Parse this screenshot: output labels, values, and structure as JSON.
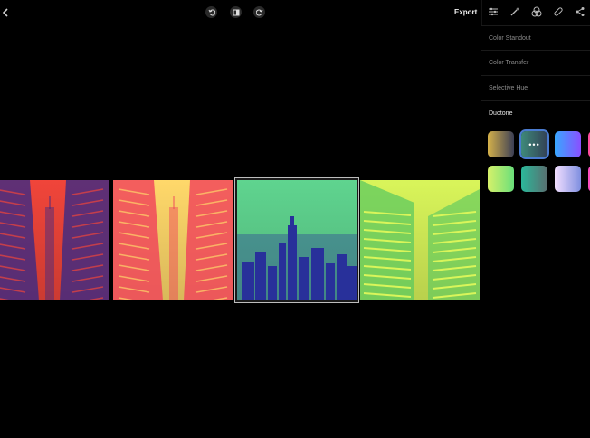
{
  "toolbar": {
    "back_icon": "chevron-left-icon",
    "undo_icon": "undo-icon",
    "compare_icon": "compare-icon",
    "redo_icon": "redo-icon",
    "export_label": "Export"
  },
  "panel_tabs": [
    "sliders-icon",
    "magic-wand-icon",
    "color-drops-icon",
    "bandage-icon",
    "share-icon"
  ],
  "panel": {
    "menu": [
      "Color Standout",
      "Color Transfer",
      "Selective Hue"
    ],
    "section_title": "Duotone",
    "swatches": [
      {
        "name": "gold-gray",
        "colors": [
          "#d6b24a",
          "#3c3f55"
        ]
      },
      {
        "name": "teal-gray",
        "colors": [
          "#3e8a7a",
          "#334055"
        ],
        "selected": true
      },
      {
        "name": "blue-violet",
        "colors": [
          "#38a8ff",
          "#8a4fff"
        ]
      },
      {
        "name": "pink",
        "colors": [
          "#ff4fa0",
          "#ff2d80"
        ]
      },
      {
        "name": "yellow-green",
        "colors": [
          "#d7f16a",
          "#6adf7a"
        ]
      },
      {
        "name": "teal",
        "colors": [
          "#2bb89a",
          "#5a6e70"
        ]
      },
      {
        "name": "lavender",
        "colors": [
          "#f3dfff",
          "#7f8fe0"
        ]
      },
      {
        "name": "magenta",
        "colors": [
          "#ff4fc0",
          "#b02fd0"
        ]
      }
    ]
  },
  "thumbnails": [
    {
      "name": "red-blue-duotone",
      "light": "#f0453a",
      "dark": "#3b2a85"
    },
    {
      "name": "yellow-red-duotone",
      "light": "#ffd86a",
      "dark": "#f0405a"
    },
    {
      "name": "green-blue-duotone",
      "light": "#5fd48f",
      "dark": "#28309a",
      "selected": true
    },
    {
      "name": "yellow-green-duotone",
      "light": "#d9f55a",
      "dark": "#5ec95f"
    }
  ]
}
